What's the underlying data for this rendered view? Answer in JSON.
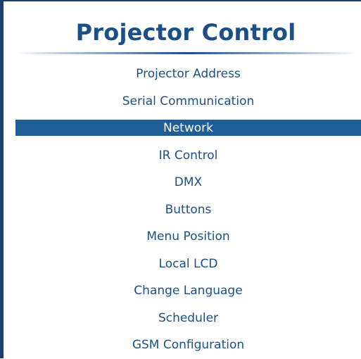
{
  "header": {
    "title": "Projector Control"
  },
  "menu": {
    "selected_index": 2,
    "items": [
      {
        "label": "Projector Address"
      },
      {
        "label": "Serial Communication"
      },
      {
        "label": "Network"
      },
      {
        "label": "IR Control"
      },
      {
        "label": "DMX"
      },
      {
        "label": "Buttons"
      },
      {
        "label": "Menu Position"
      },
      {
        "label": "Local LCD"
      },
      {
        "label": "Change Language"
      },
      {
        "label": "Scheduler"
      },
      {
        "label": "GSM Configuration"
      }
    ]
  },
  "colors": {
    "title": "#1b4f88",
    "highlight": "#1e5d97",
    "frame": "#1d3f6e"
  }
}
